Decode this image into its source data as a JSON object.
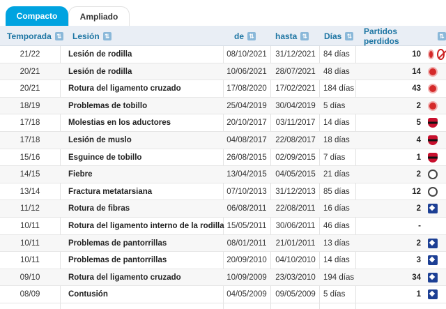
{
  "tabs": {
    "compact": "Compacto",
    "expanded": "Ampliado"
  },
  "headers": {
    "season": "Temporada",
    "injury": "Lesión",
    "from": "de",
    "to": "hasta",
    "days": "Días",
    "games_missed": "Partidos perdidos"
  },
  "rows": [
    {
      "season": "21/22",
      "injury": "Lesión de rodilla",
      "from": "08/10/2021",
      "to": "31/12/2021",
      "days": "84 días",
      "games": "10",
      "club": "red",
      "extra": "ban"
    },
    {
      "season": "20/21",
      "injury": "Lesión de rodilla",
      "from": "10/06/2021",
      "to": "28/07/2021",
      "days": "48 días",
      "games": "14",
      "club": "red"
    },
    {
      "season": "20/21",
      "injury": "Rotura del ligamento cruzado",
      "from": "17/08/2020",
      "to": "17/02/2021",
      "days": "184 días",
      "games": "43",
      "club": "red"
    },
    {
      "season": "18/19",
      "injury": "Problemas de tobillo",
      "from": "25/04/2019",
      "to": "30/04/2019",
      "days": "5 días",
      "games": "2",
      "club": "red"
    },
    {
      "season": "17/18",
      "injury": "Molestias en los aductores",
      "from": "20/10/2017",
      "to": "03/11/2017",
      "days": "14 días",
      "games": "5",
      "club": "flame"
    },
    {
      "season": "17/18",
      "injury": "Lesión de muslo",
      "from": "04/08/2017",
      "to": "22/08/2017",
      "days": "18 días",
      "games": "4",
      "club": "flame"
    },
    {
      "season": "15/16",
      "injury": "Esguince de tobillo",
      "from": "26/08/2015",
      "to": "02/09/2015",
      "days": "7 días",
      "games": "1",
      "club": "flame"
    },
    {
      "season": "14/15",
      "injury": "Fiebre",
      "from": "13/04/2015",
      "to": "04/05/2015",
      "days": "21 días",
      "games": "2",
      "club": "corinthians"
    },
    {
      "season": "13/14",
      "injury": "Fractura metatarsiana",
      "from": "07/10/2013",
      "to": "31/12/2013",
      "days": "85 días",
      "games": "12",
      "club": "corinthians"
    },
    {
      "season": "11/12",
      "injury": "Rotura de fibras",
      "from": "06/08/2011",
      "to": "22/08/2011",
      "days": "16 días",
      "games": "2",
      "club": "hamburg"
    },
    {
      "season": "10/11",
      "injury": "Rotura del ligamento interno de la rodilla",
      "from": "15/05/2011",
      "to": "30/06/2011",
      "days": "46 días",
      "games": "-",
      "club": ""
    },
    {
      "season": "10/11",
      "injury": "Problemas de pantorrillas",
      "from": "08/01/2011",
      "to": "21/01/2011",
      "days": "13 días",
      "games": "2",
      "club": "hamburg"
    },
    {
      "season": "10/11",
      "injury": "Problemas de pantorrillas",
      "from": "20/09/2010",
      "to": "04/10/2010",
      "days": "14 días",
      "games": "3",
      "club": "hamburg"
    },
    {
      "season": "09/10",
      "injury": "Rotura del ligamento cruzado",
      "from": "10/09/2009",
      "to": "23/03/2010",
      "days": "194 días",
      "games": "34",
      "club": "hamburg"
    },
    {
      "season": "08/09",
      "injury": "Contusión",
      "from": "04/05/2009",
      "to": "09/05/2009",
      "days": "5 días",
      "games": "1",
      "club": "hamburg"
    }
  ]
}
